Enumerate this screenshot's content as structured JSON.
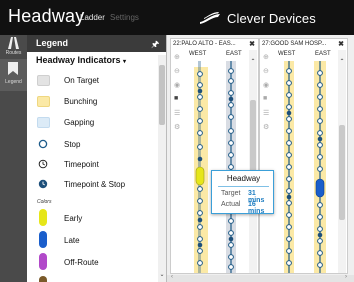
{
  "header": {
    "app_title": "Headway",
    "tabs": [
      {
        "label": "Ladder",
        "active": true
      },
      {
        "label": "Settings",
        "active": false
      }
    ],
    "brand": "Clever Devices"
  },
  "rail": {
    "items": [
      {
        "label": "Routes",
        "icon": "routes-icon"
      },
      {
        "label": "Legend",
        "icon": "bookmark-icon",
        "active": true
      }
    ]
  },
  "legend": {
    "title": "Legend",
    "pin_icon": "pin-icon",
    "section_title": "Headway Indicators",
    "indicators": [
      {
        "label": "On Target",
        "color": "#e3e3e3"
      },
      {
        "label": "Bunching",
        "color": "#fbe9a6"
      },
      {
        "label": "Gapping",
        "color": "#dcebf7"
      },
      {
        "label": "Stop",
        "icon": "stop-circle-icon"
      },
      {
        "label": "Timepoint",
        "icon": "timepoint-clock-icon"
      },
      {
        "label": "Timepoint & Stop",
        "icon": "timepoint-stop-icon"
      }
    ],
    "colors_caption": "Colors",
    "color_items": [
      {
        "label": "Early",
        "color": "#e6e619"
      },
      {
        "label": "Late",
        "color": "#1a5ecb"
      },
      {
        "label": "Off-Route",
        "color": "#b149c9"
      }
    ]
  },
  "ladders": [
    {
      "title": "22:PALO ALTO - EAS...",
      "dir_left": "WEST",
      "dir_right": "EAST"
    },
    {
      "title": "27:GOOD SAM HOSP...",
      "dir_left": "WEST",
      "dir_right": "EAST"
    }
  ],
  "tooltip": {
    "title": "Headway",
    "target_label": "Target",
    "target_value": "31 mins",
    "actual_label": "Actual",
    "actual_value": "16 mins"
  },
  "colors": {
    "header_bg": "#111111",
    "rail_bg": "#4a4a4a",
    "accent_blue": "#1a7bc0",
    "early": "#e6e619",
    "late": "#1a5ecb"
  }
}
